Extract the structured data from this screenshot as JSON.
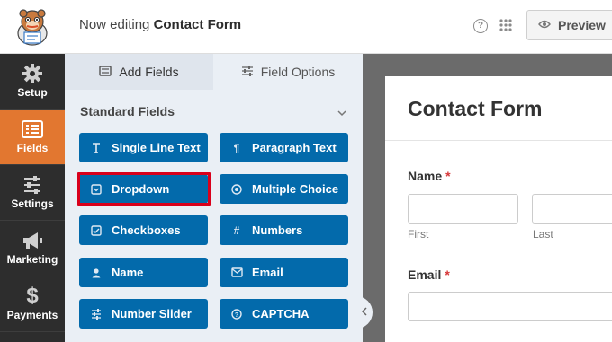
{
  "header": {
    "editing_prefix": "Now editing",
    "form_name": "Contact Form",
    "help_icon": "?",
    "preview_label": "Preview"
  },
  "sidebar": {
    "items": [
      {
        "label": "Setup",
        "icon": "gear-icon"
      },
      {
        "label": "Fields",
        "icon": "fields-icon",
        "active": true
      },
      {
        "label": "Settings",
        "icon": "sliders-icon"
      },
      {
        "label": "Marketing",
        "icon": "megaphone-icon"
      },
      {
        "label": "Payments",
        "icon": "dollar-icon"
      }
    ]
  },
  "panel": {
    "tabs": [
      {
        "label": "Add Fields",
        "active": true
      },
      {
        "label": "Field Options",
        "active": false
      }
    ],
    "section_title": "Standard Fields",
    "fields": [
      {
        "label": "Single Line Text",
        "icon": "text-cursor-icon"
      },
      {
        "label": "Paragraph Text",
        "icon": "paragraph-icon"
      },
      {
        "label": "Dropdown",
        "icon": "dropdown-icon",
        "highlighted": true
      },
      {
        "label": "Multiple Choice",
        "icon": "radio-icon"
      },
      {
        "label": "Checkboxes",
        "icon": "checkbox-icon"
      },
      {
        "label": "Numbers",
        "icon": "hash-icon"
      },
      {
        "label": "Name",
        "icon": "user-icon"
      },
      {
        "label": "Email",
        "icon": "envelope-icon"
      },
      {
        "label": "Number Slider",
        "icon": "slider-icon"
      },
      {
        "label": "CAPTCHA",
        "icon": "question-circle-icon"
      }
    ]
  },
  "form_preview": {
    "title": "Contact Form",
    "name_label": "Name",
    "required_mark": "*",
    "first_label": "First",
    "last_label": "Last",
    "email_label": "Email"
  },
  "colors": {
    "accent": "#e27730",
    "button": "#036aab",
    "nav_bg": "#2d2d2d",
    "highlight": "#d9001b",
    "required": "#d63638"
  }
}
